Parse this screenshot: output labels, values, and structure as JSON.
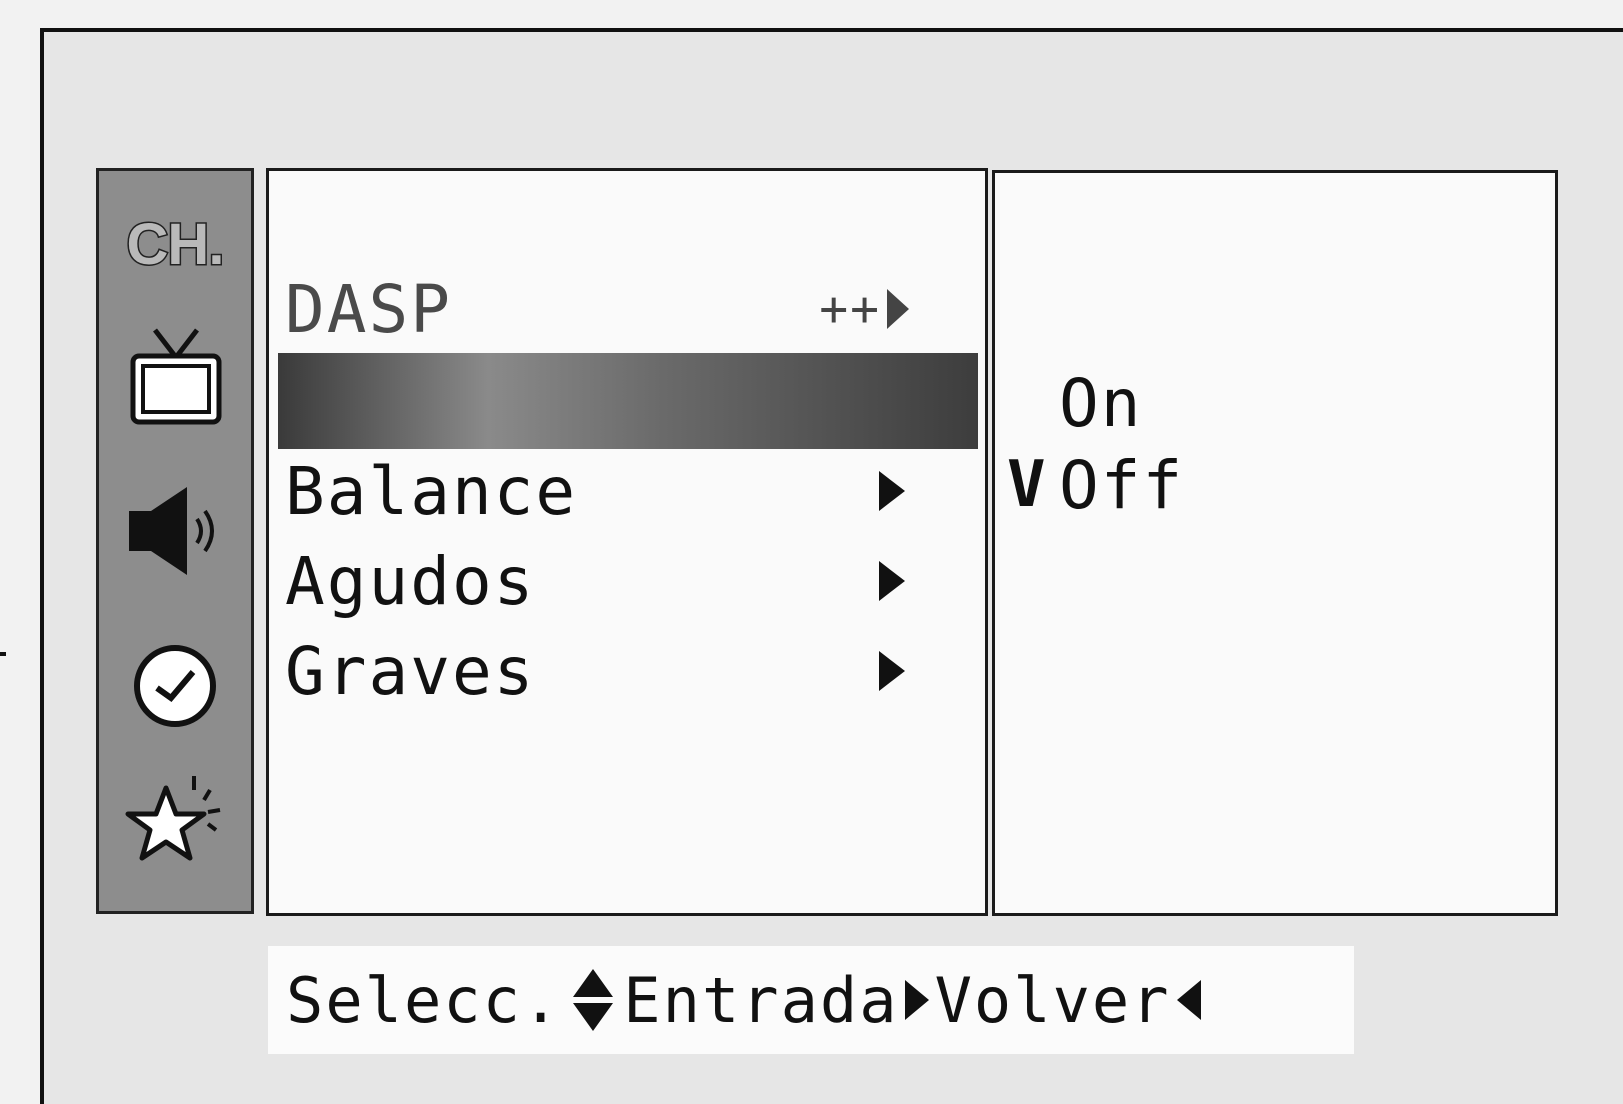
{
  "sidebar": {
    "items": [
      {
        "label": "CH.",
        "icon": "channel-icon"
      },
      {
        "icon": "tv-icon"
      },
      {
        "icon": "speaker-icon"
      },
      {
        "icon": "clock-icon"
      },
      {
        "icon": "star-icon"
      }
    ]
  },
  "menu": {
    "items": [
      {
        "label": "DASP",
        "state": "disabled"
      },
      {
        "label": "",
        "state": "selected"
      },
      {
        "label": "Balance"
      },
      {
        "label": "Agudos"
      },
      {
        "label": "Graves"
      }
    ]
  },
  "submenu": {
    "options": [
      {
        "label": "On",
        "checked": false
      },
      {
        "label": "Off",
        "checked": true,
        "check_mark": "V"
      }
    ]
  },
  "footer": {
    "select_label": "Selecc.",
    "enter_label": "Entrada",
    "back_label": "Volver"
  },
  "colors": {
    "sidebar_bg": "#8d8d8d",
    "highlight": "#5a5a5a",
    "panel_bg": "#fafafa"
  }
}
